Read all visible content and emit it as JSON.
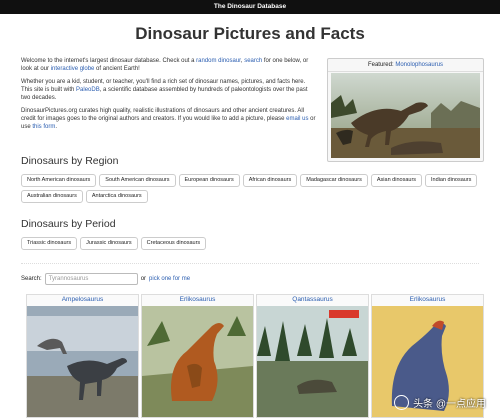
{
  "topbar": {
    "title": "The Dinosaur Database"
  },
  "page_title": "Dinosaur Pictures and Facts",
  "intro": {
    "p1_a": "Welcome to the internet's largest dinosaur database. Check out a ",
    "p1_link1": "random dinosaur",
    "p1_b": ", ",
    "p1_link2": "search",
    "p1_c": " for one below, or look at our ",
    "p1_link3": "interactive globe",
    "p1_d": " of ancient Earth!",
    "p2_a": "Whether you are a kid, student, or teacher, you'll find a rich set of dinosaur names, pictures, and facts here. This site is built with ",
    "p2_link": "PaleoDB",
    "p2_b": ", a scientific database assembled by hundreds of paleontologists over the past two decades.",
    "p3_a": "DinosaurPictures.org curates high quality, realistic illustrations of dinosaurs and other ancient creatures. All credit for images goes to the original authors and creators. If you would like to add a picture, please ",
    "p3_link1": "email us",
    "p3_b": " or use ",
    "p3_link2": "this form",
    "p3_c": "."
  },
  "featured": {
    "label": "Featured: ",
    "name": "Monolophosaurus"
  },
  "region": {
    "heading": "Dinosaurs by Region",
    "items": [
      "North American dinosaurs",
      "South American dinosaurs",
      "European dinosaurs",
      "African dinosaurs",
      "Madagascar dinosaurs",
      "Asian dinosaurs",
      "Indian dinosaurs",
      "Australian dinosaurs",
      "Antarctica dinosaurs"
    ]
  },
  "period": {
    "heading": "Dinosaurs by Period",
    "items": [
      "Triassic dinosaurs",
      "Jurassic dinosaurs",
      "Cretaceous dinosaurs"
    ]
  },
  "search": {
    "label": "Search:",
    "placeholder": "Tyrannosaurus",
    "or_text": "or",
    "link": "pick one for me"
  },
  "cards": [
    {
      "name": "Ampelosaurus"
    },
    {
      "name": "Erlikosaurus"
    },
    {
      "name": "Qantassaurus"
    },
    {
      "name": "Erlikosaurus"
    }
  ],
  "watermark": {
    "text": "头条 @一点应用"
  }
}
